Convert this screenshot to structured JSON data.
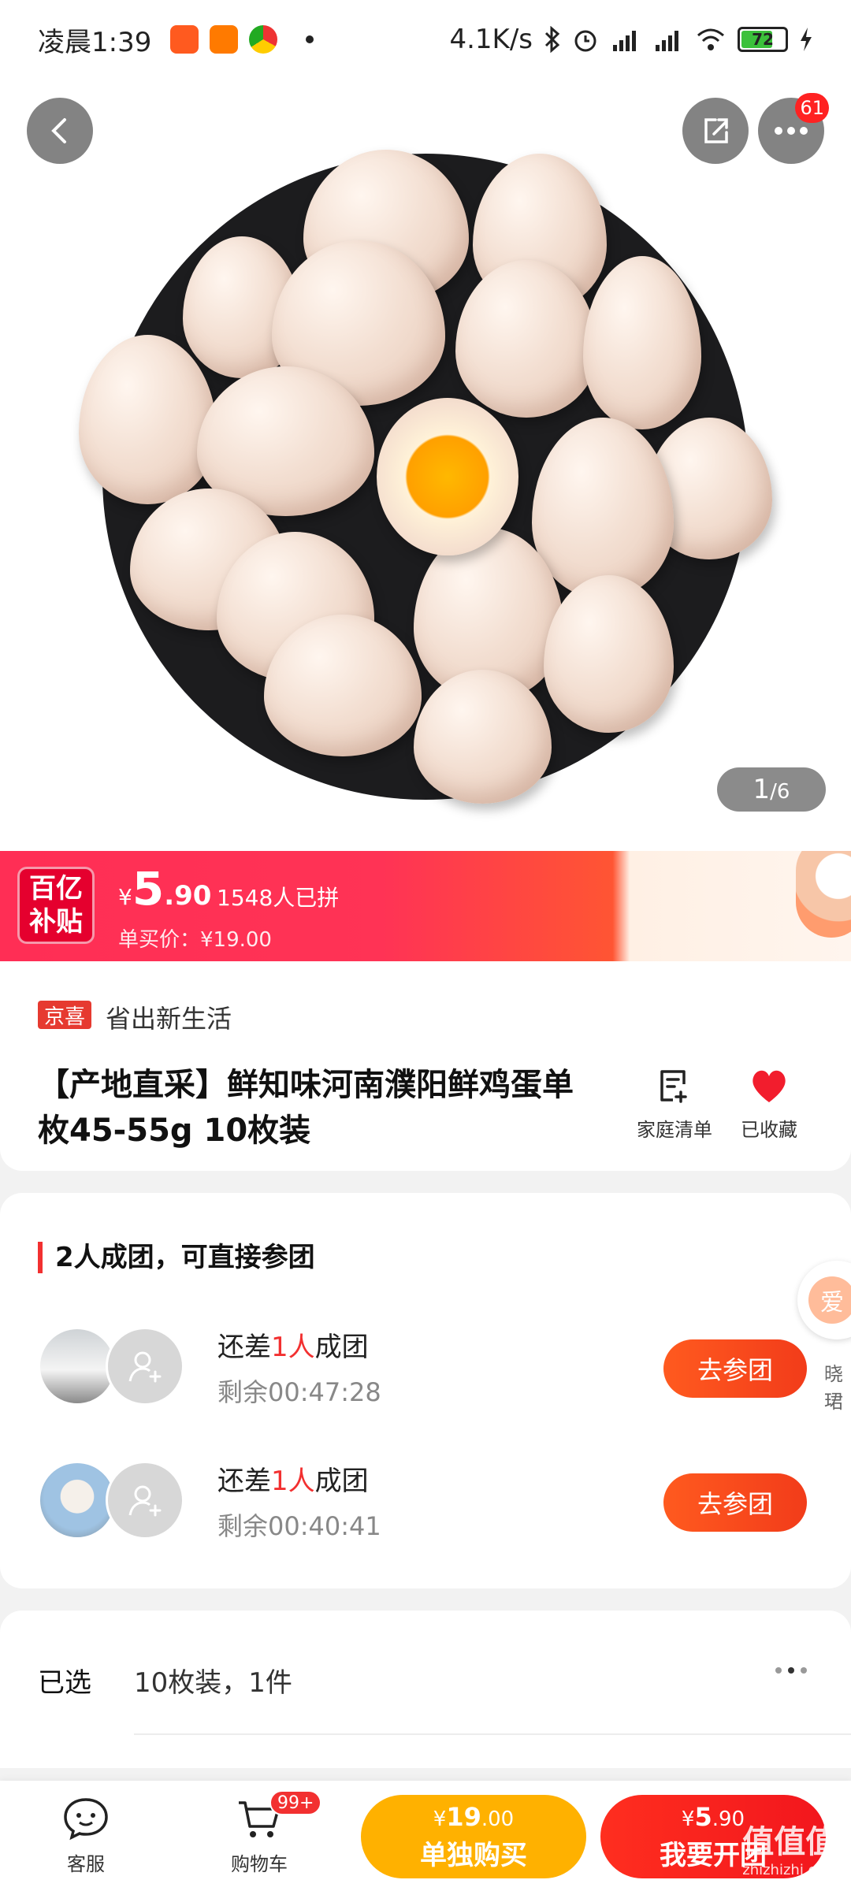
{
  "status_bar": {
    "time": "凌晨1:39",
    "network_speed": "4.1K/s",
    "battery": "72",
    "icons": [
      "taobao-app-icon",
      "mi-app-icon",
      "chrome-app-icon",
      "bluetooth-icon",
      "alarm-icon",
      "signal-hd-icon",
      "signal-hd-icon",
      "wifi-icon",
      "battery-icon",
      "charging-icon"
    ]
  },
  "hero": {
    "more_badge": "61",
    "pager_current": "1",
    "pager_total": "/6"
  },
  "price_banner": {
    "subsidy_line1": "百亿",
    "subsidy_line2": "补贴",
    "currency": "¥",
    "price_int": "5",
    "price_dec": ".90",
    "group_count": "1548人已拼",
    "single_price": "单买价：¥19.00"
  },
  "product": {
    "tag": "京喜",
    "tagline": "省出新生活",
    "title": "【产地直采】鲜知味河南濮阳鲜鸡蛋单枚45-55g 10枚装",
    "action_list": "家庭清单",
    "action_fav": "已收藏"
  },
  "groups": {
    "heading": "2人成团，可直接参团",
    "rows": [
      {
        "need_prefix": "还差",
        "need_num": "1人",
        "need_suffix": "成团",
        "remain": "剩余00:47:28",
        "button": "去参团"
      },
      {
        "need_prefix": "还差",
        "need_num": "1人",
        "need_suffix": "成团",
        "remain": "剩余00:40:41",
        "button": "去参团"
      }
    ],
    "float_char": "爱",
    "float_label": "晓珺"
  },
  "selection": {
    "label": "已选",
    "value": "10枚装，1件"
  },
  "bottom_bar": {
    "service": "客服",
    "cart": "购物车",
    "cart_badge": "99+",
    "single_price_cur": "¥",
    "single_price_int": "19",
    "single_price_dec": ".00",
    "single_label": "单独购买",
    "group_price_cur": "¥",
    "group_price_int": "5",
    "group_price_dec": ".90",
    "group_label": "我要开团"
  },
  "watermark": {
    "text": "值值值",
    "sub": "zhizhizhi.com"
  },
  "colors": {
    "accent_red": "#f23030",
    "subsidy_pink": "#ff2e55",
    "single_buy_yellow": "#ffb100"
  }
}
